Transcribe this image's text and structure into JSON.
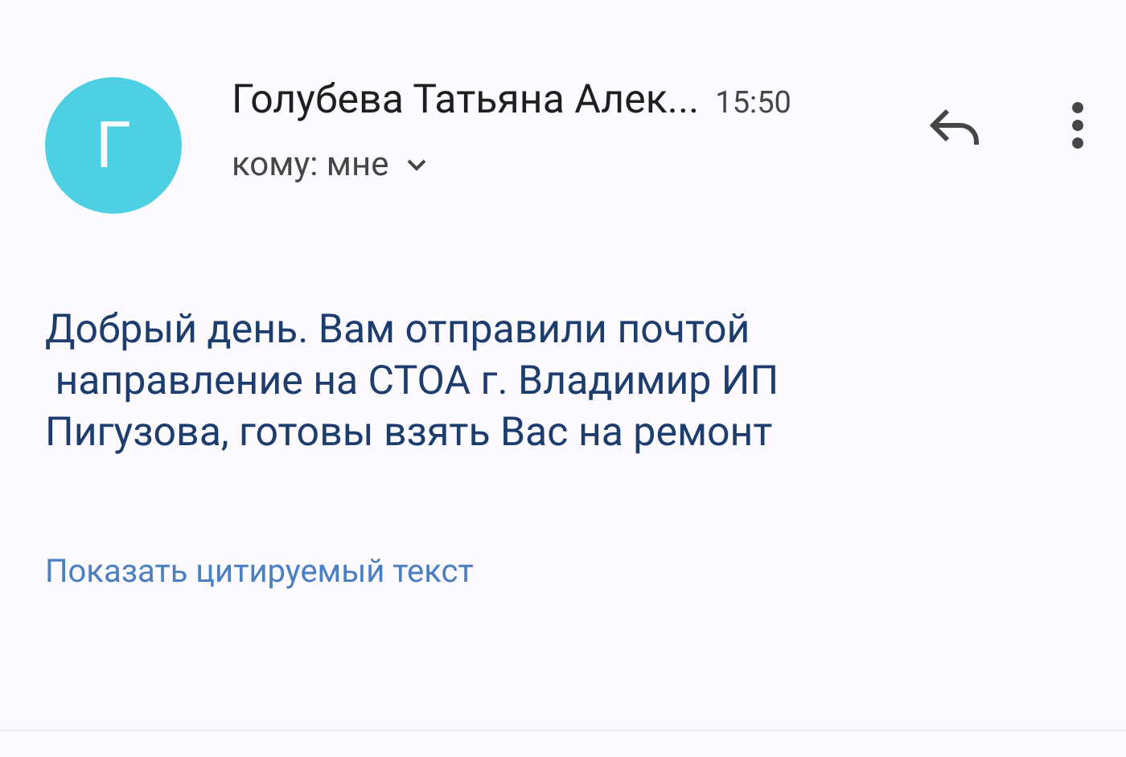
{
  "message": {
    "avatar_letter": "Г",
    "sender": "Голубева Татьяна Алек...",
    "time": "15:50",
    "recipient": "кому: мне",
    "body": "Добрый день. Вам отправили почтой\n направление на СТОА г. Владимир ИП\nПигузова, готовы взять Вас на ремонт",
    "show_quoted": "Показать цитируемый текст"
  }
}
